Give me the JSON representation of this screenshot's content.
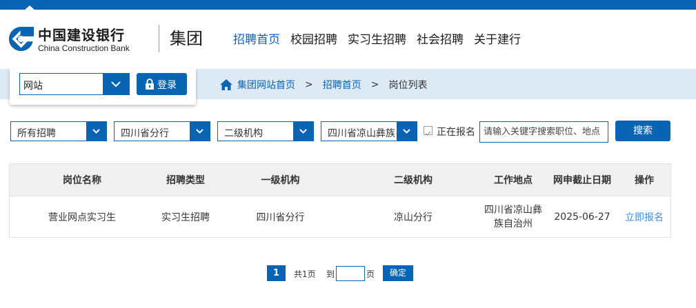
{
  "brand": {
    "name_cn": "中国建设银行",
    "name_en": "China Construction Bank",
    "group": "集团",
    "accent_color": "#0a64b4",
    "logo_icon": "ccb-logo-icon"
  },
  "nav": {
    "items": [
      {
        "label": "招聘首页",
        "active": true
      },
      {
        "label": "校园招聘",
        "active": false
      },
      {
        "label": "实习生招聘",
        "active": false
      },
      {
        "label": "社会招聘",
        "active": false
      },
      {
        "label": "关于建行",
        "active": false
      }
    ]
  },
  "login": {
    "site_select": "网站",
    "button_label": "登录"
  },
  "breadcrumb": {
    "home": "集团网站首页",
    "recruit": "招聘首页",
    "separator": ">",
    "current": "岗位列表"
  },
  "filters": {
    "type": "所有招聘",
    "level1": "四川省分行",
    "level2": "二级机构",
    "location": "四川省凉山彝族",
    "checkbox_label": "正在报名",
    "checkbox_checked": false,
    "keyword_placeholder": "请输入关键字搜索职位、地点",
    "search_label": "搜索"
  },
  "table": {
    "headers": [
      "岗位名称",
      "招聘类型",
      "一级机构",
      "二级机构",
      "工作地点",
      "网申截止日期",
      "操作"
    ],
    "rows": [
      {
        "title": "营业网点实习生",
        "type": "实习生招聘",
        "level1": "四川省分行",
        "level2": "凉山分行",
        "location": "四川省凉山彝族自治州",
        "deadline": "2025-06-27",
        "action": "立即报名"
      }
    ]
  },
  "pager": {
    "current": "1",
    "total": "共1页",
    "goto_prefix": "到",
    "goto_suffix": "页",
    "confirm": "确定"
  }
}
